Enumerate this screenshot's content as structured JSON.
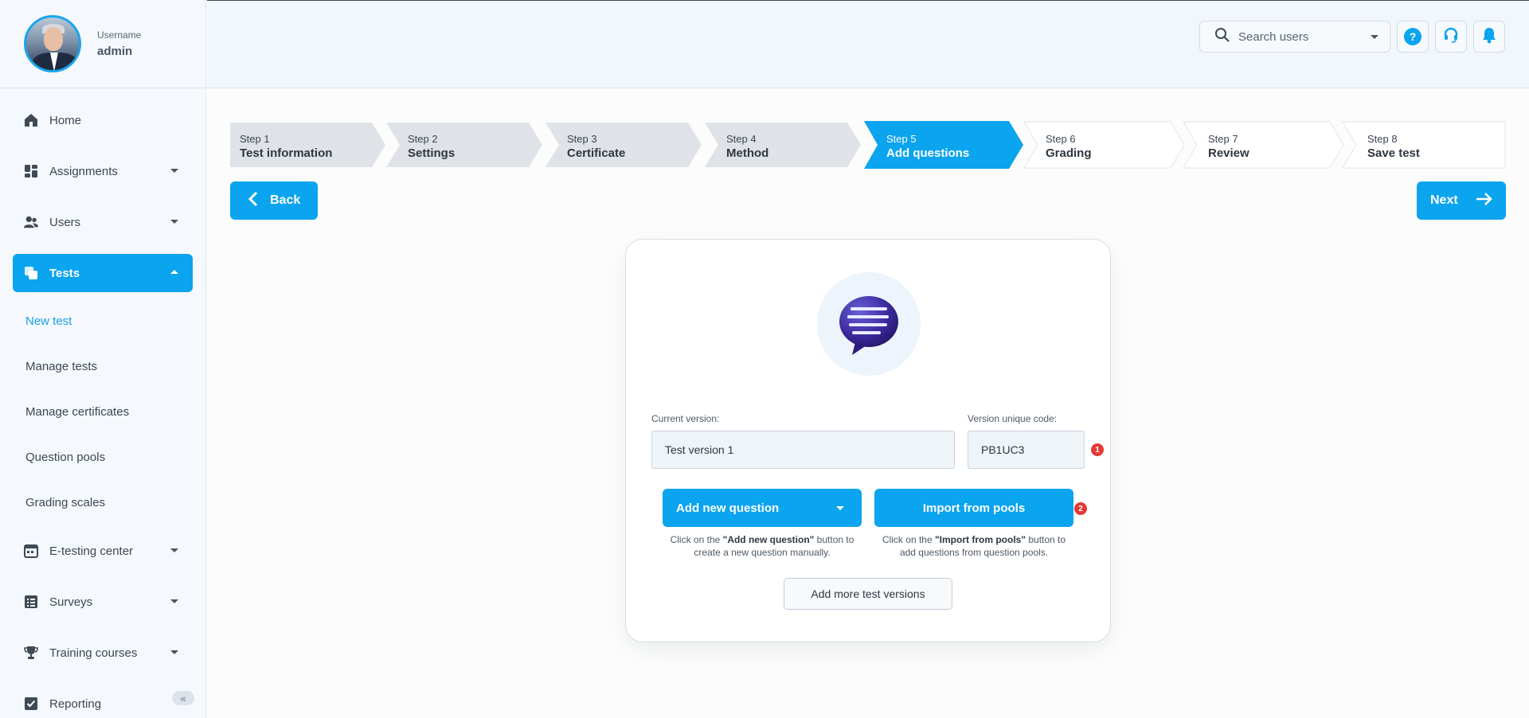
{
  "user": {
    "label": "Username",
    "name": "admin"
  },
  "sidebar": {
    "items": [
      {
        "label": "Home"
      },
      {
        "label": "Assignments"
      },
      {
        "label": "Users"
      },
      {
        "label": "Tests"
      },
      {
        "label": "E-testing center"
      },
      {
        "label": "Surveys"
      },
      {
        "label": "Training courses"
      },
      {
        "label": "Reporting"
      }
    ],
    "tests_sub": [
      {
        "label": "New test"
      },
      {
        "label": "Manage tests"
      },
      {
        "label": "Manage certificates"
      },
      {
        "label": "Question pools"
      },
      {
        "label": "Grading scales"
      }
    ],
    "collapse_glyph": "«"
  },
  "header": {
    "search_placeholder": "Search users",
    "help_glyph": "?"
  },
  "stepper": [
    {
      "num": "Step 1",
      "label": "Test information"
    },
    {
      "num": "Step 2",
      "label": "Settings"
    },
    {
      "num": "Step 3",
      "label": "Certificate"
    },
    {
      "num": "Step 4",
      "label": "Method"
    },
    {
      "num": "Step 5",
      "label": "Add questions"
    },
    {
      "num": "Step 6",
      "label": "Grading"
    },
    {
      "num": "Step 7",
      "label": "Review"
    },
    {
      "num": "Step 8",
      "label": "Save test"
    }
  ],
  "nav_buttons": {
    "back": "Back",
    "next": "Next"
  },
  "card": {
    "current_version_label": "Current version:",
    "current_version_value": "Test version 1",
    "code_label": "Version unique code:",
    "code_value": "PB1UC3",
    "badge1": "1",
    "badge2": "2",
    "add_question": "Add new question",
    "import_pools": "Import from pools",
    "hint_add_pre": "Click on the ",
    "hint_add_bold": "\"Add new question\"",
    "hint_add_post": " button to create a new question manually.",
    "hint_import_pre": "Click on the ",
    "hint_import_bold": "\"Import from pools\"",
    "hint_import_post": " button to add questions from question pools.",
    "add_versions": "Add more test versions"
  },
  "colors": {
    "accent": "#0ba4ee",
    "badge": "#e53935"
  }
}
